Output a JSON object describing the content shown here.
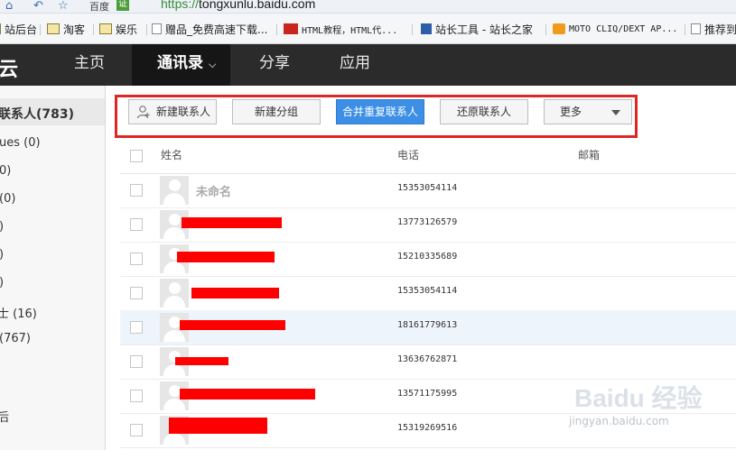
{
  "browser": {
    "baidu_label": "百度",
    "verify_label": "证",
    "url_protocol": "https://",
    "url_host": "tongxunlu.baidu.com"
  },
  "bookmarks": [
    {
      "label": "站后台",
      "icon": "folder-icon"
    },
    {
      "label": "淘客",
      "icon": "folder-icon"
    },
    {
      "label": "娱乐",
      "icon": "folder-icon"
    },
    {
      "label": "赠品_免费高速下载...",
      "icon": "page-icon"
    },
    {
      "label": "HTML教程，HTML代...",
      "icon": "red-logo-icon"
    },
    {
      "label": "站长工具 - 站长之家",
      "icon": "blue-logo-icon"
    },
    {
      "label": "MOTO CLIQ/DEXT AP...",
      "icon": "orange-logo-icon"
    },
    {
      "label": "推荐到",
      "icon": "page-icon"
    }
  ],
  "topnav": {
    "logo": "云",
    "items": [
      "主页",
      "通讯录",
      "分享",
      "应用"
    ],
    "active_index": 1
  },
  "sidebar": {
    "header": "联系人(783)",
    "items": [
      "ues (0)",
      "0)",
      "(0)",
      ")",
      ")",
      ")",
      "士 (16)",
      "(767)",
      "后"
    ]
  },
  "toolbar": {
    "new_contact": "新建联系人",
    "new_group": "新建分组",
    "merge_duplicates": "合并重复联系人",
    "restore_contacts": "还原联系人",
    "more": "更多"
  },
  "table": {
    "columns": {
      "name": "姓名",
      "phone": "电话",
      "email": "邮箱"
    },
    "rows": [
      {
        "name": "未命名",
        "phone": "15353054114"
      },
      {
        "name": "",
        "phone": "13773126579"
      },
      {
        "name": "",
        "phone": "15210335689"
      },
      {
        "name": "",
        "phone": "15353054114"
      },
      {
        "name": "",
        "phone": "18161779613"
      },
      {
        "name": "",
        "phone": "13636762871"
      },
      {
        "name": "",
        "phone": "13571175995"
      },
      {
        "name": "",
        "phone": "15319269516"
      }
    ]
  },
  "watermark": {
    "brand": "Baidu 经验",
    "url": "jingyan.baidu.com"
  }
}
